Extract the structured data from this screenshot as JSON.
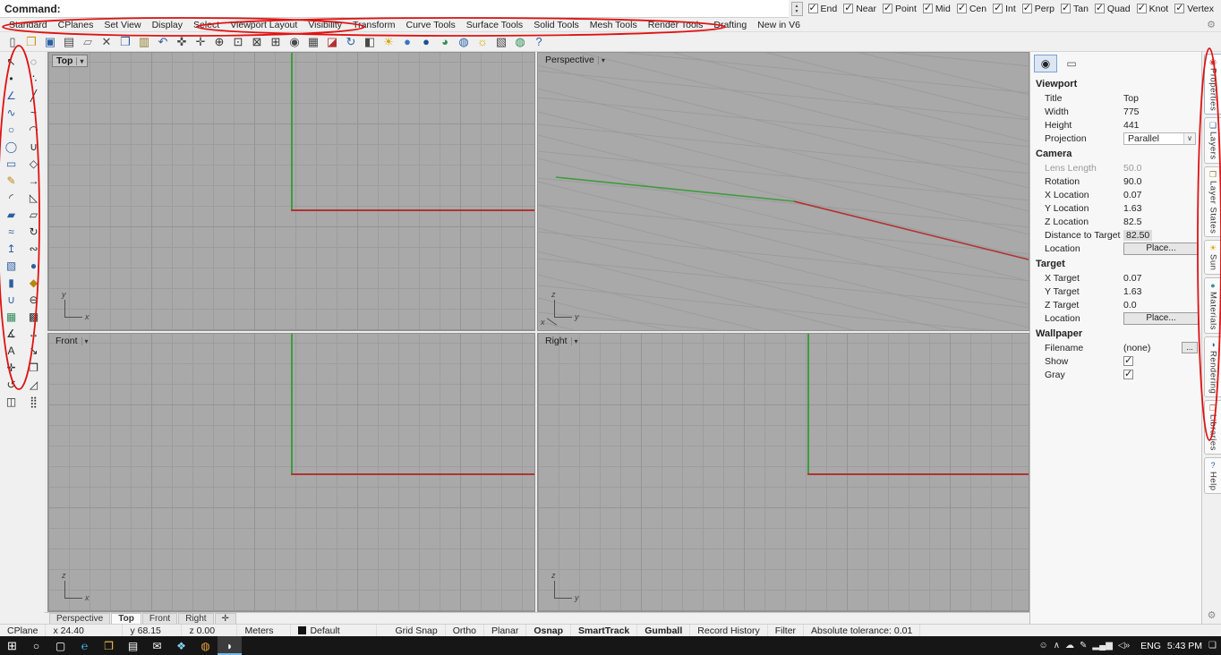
{
  "command_bar": {
    "label": "Command:",
    "value": ""
  },
  "osnap_toggles": [
    {
      "label": "End",
      "checked": true
    },
    {
      "label": "Near",
      "checked": true
    },
    {
      "label": "Point",
      "checked": true
    },
    {
      "label": "Mid",
      "checked": true
    },
    {
      "label": "Cen",
      "checked": true
    },
    {
      "label": "Int",
      "checked": true
    },
    {
      "label": "Perp",
      "checked": true
    },
    {
      "label": "Tan",
      "checked": true
    },
    {
      "label": "Quad",
      "checked": true
    },
    {
      "label": "Knot",
      "checked": true
    },
    {
      "label": "Vertex",
      "checked": true
    }
  ],
  "menu_tabs": [
    "Standard",
    "CPlanes",
    "Set View",
    "Display",
    "Select",
    "Viewport Layout",
    "Visibility",
    "Transform",
    "Curve Tools",
    "Surface Tools",
    "Solid Tools",
    "Mesh Tools",
    "Render Tools",
    "Drafting",
    "New in V6"
  ],
  "toolbar_icons": [
    {
      "name": "new-file-icon",
      "glyph": "▯",
      "color": "#4a4a4a"
    },
    {
      "name": "open-file-icon",
      "glyph": "❒",
      "color": "#c9971f"
    },
    {
      "name": "save-icon",
      "glyph": "▣",
      "color": "#2e5fa3"
    },
    {
      "name": "print-icon",
      "glyph": "▤",
      "color": "#4a4a4a"
    },
    {
      "name": "export-icon",
      "glyph": "▱",
      "color": "#777777"
    },
    {
      "name": "cut-icon",
      "glyph": "✕",
      "color": "#4a4a4a"
    },
    {
      "name": "copy-icon",
      "glyph": "❐",
      "color": "#2e5fa3"
    },
    {
      "name": "paste-icon",
      "glyph": "▥",
      "color": "#8a7a2a"
    },
    {
      "name": "undo-icon",
      "glyph": "↶",
      "color": "#2e5fa3"
    },
    {
      "name": "pan-icon",
      "glyph": "✜",
      "color": "#4a4a4a"
    },
    {
      "name": "move-icon",
      "glyph": "✛",
      "color": "#4a4a4a"
    },
    {
      "name": "zoom-dynamic-icon",
      "glyph": "⊕",
      "color": "#333333"
    },
    {
      "name": "zoom-window-icon",
      "glyph": "⊡",
      "color": "#333333"
    },
    {
      "name": "zoom-extents-icon",
      "glyph": "⊠",
      "color": "#333333"
    },
    {
      "name": "zoom-selected-icon",
      "glyph": "⊞",
      "color": "#333333"
    },
    {
      "name": "selection-filter-icon",
      "glyph": "◉",
      "color": "#4a4a4a"
    },
    {
      "name": "grid-table-icon",
      "glyph": "▦",
      "color": "#4a4a4a"
    },
    {
      "name": "erase-icon",
      "glyph": "◪",
      "color": "#b03333"
    },
    {
      "name": "rotate-view-icon",
      "glyph": "↻",
      "color": "#2e5fa3"
    },
    {
      "name": "set-view-icon",
      "glyph": "◧",
      "color": "#4a4a4a"
    },
    {
      "name": "lamp-icon",
      "glyph": "☀",
      "color": "#d8a400"
    },
    {
      "name": "shaded-view-icon",
      "glyph": "●",
      "color": "#3b74c4"
    },
    {
      "name": "rendered-view-icon",
      "glyph": "●",
      "color": "#1f4f8f"
    },
    {
      "name": "rotate-sphere-icon",
      "glyph": "◕",
      "color": "#2e8b57"
    },
    {
      "name": "globe-icon",
      "glyph": "◍",
      "color": "#2e5fa3"
    },
    {
      "name": "sun-icon",
      "glyph": "☼",
      "color": "#d8a400"
    },
    {
      "name": "cplane-icon",
      "glyph": "▧",
      "color": "#4a4a4a"
    },
    {
      "name": "earth-icon",
      "glyph": "◍",
      "color": "#2e8b57"
    },
    {
      "name": "help-icon",
      "glyph": "?",
      "color": "#2e5fa3"
    }
  ],
  "left_toolbar_icons": [
    {
      "name": "select-pointer-icon",
      "glyph": "↖",
      "color": "#2b2b2b"
    },
    {
      "name": "lasso-select-icon",
      "glyph": "◌",
      "color": "#2b2b2b"
    },
    {
      "name": "point-icon",
      "glyph": "•",
      "color": "#2b2b2b"
    },
    {
      "name": "point-cloud-icon",
      "glyph": "∴",
      "color": "#2b2b2b"
    },
    {
      "name": "polyline-icon",
      "glyph": "∠",
      "color": "#2e5fa3"
    },
    {
      "name": "line-icon",
      "glyph": "╱",
      "color": "#2b2b2b"
    },
    {
      "name": "curve-icon",
      "glyph": "∿",
      "color": "#2e5fa3"
    },
    {
      "name": "interpolate-curve-icon",
      "glyph": "~",
      "color": "#2b2b2b"
    },
    {
      "name": "circle-icon",
      "glyph": "○",
      "color": "#2e5fa3"
    },
    {
      "name": "arc-icon",
      "glyph": "◠",
      "color": "#2b2b2b"
    },
    {
      "name": "ellipse-icon",
      "glyph": "◯",
      "color": "#2e5fa3"
    },
    {
      "name": "conic-icon",
      "glyph": "∪",
      "color": "#2b2b2b"
    },
    {
      "name": "rectangle-icon",
      "glyph": "▭",
      "color": "#2e5fa3"
    },
    {
      "name": "polygon-icon",
      "glyph": "◇",
      "color": "#2b2b2b"
    },
    {
      "name": "curve-tools-icon",
      "glyph": "✎",
      "color": "#b8860b"
    },
    {
      "name": "extend-curve-icon",
      "glyph": "→",
      "color": "#2b2b2b"
    },
    {
      "name": "fillet-corner-icon",
      "glyph": "◜",
      "color": "#2b2b2b"
    },
    {
      "name": "chamfer-corner-icon",
      "glyph": "◺",
      "color": "#2b2b2b"
    },
    {
      "name": "surface-icon",
      "glyph": "▰",
      "color": "#2e5fa3"
    },
    {
      "name": "surface-corner-points-icon",
      "glyph": "▱",
      "color": "#2b2b2b"
    },
    {
      "name": "loft-icon",
      "glyph": "≈",
      "color": "#2e5fa3"
    },
    {
      "name": "revolve-icon",
      "glyph": "↻",
      "color": "#2b2b2b"
    },
    {
      "name": "extrude-icon",
      "glyph": "↥",
      "color": "#2e5fa3"
    },
    {
      "name": "sweep-icon",
      "glyph": "∾",
      "color": "#2b2b2b"
    },
    {
      "name": "box-icon",
      "glyph": "▧",
      "color": "#2e5fa3"
    },
    {
      "name": "sphere-icon",
      "glyph": "●",
      "color": "#2e5fa3"
    },
    {
      "name": "cylinder-icon",
      "glyph": "▮",
      "color": "#2e5fa3"
    },
    {
      "name": "solid-tools-icon",
      "glyph": "◆",
      "color": "#b8860b"
    },
    {
      "name": "boolean-union-icon",
      "glyph": "∪",
      "color": "#2e5fa3"
    },
    {
      "name": "boolean-difference-icon",
      "glyph": "⊖",
      "color": "#2b2b2b"
    },
    {
      "name": "mesh-icon",
      "glyph": "▦",
      "color": "#2e8b57"
    },
    {
      "name": "mesh-tools-icon",
      "glyph": "▩",
      "color": "#2b2b2b"
    },
    {
      "name": "analyze-icon",
      "glyph": "∡",
      "color": "#2b2b2b"
    },
    {
      "name": "dimension-icon",
      "glyph": "↔",
      "color": "#2b2b2b"
    },
    {
      "name": "text-icon",
      "glyph": "A",
      "color": "#2b2b2b"
    },
    {
      "name": "leader-icon",
      "glyph": "↘",
      "color": "#2b2b2b"
    },
    {
      "name": "move-tool-icon",
      "glyph": "✛",
      "color": "#2b2b2b"
    },
    {
      "name": "copy-tool-icon",
      "glyph": "❐",
      "color": "#2b2b2b"
    },
    {
      "name": "rotate-tool-icon",
      "glyph": "↺",
      "color": "#2b2b2b"
    },
    {
      "name": "scale-tool-icon",
      "glyph": "◿",
      "color": "#2b2b2b"
    },
    {
      "name": "mirror-icon",
      "glyph": "◫",
      "color": "#2b2b2b"
    },
    {
      "name": "array-icon",
      "glyph": "⣿",
      "color": "#2b2b2b"
    }
  ],
  "viewports": {
    "top": {
      "title": "Top",
      "axis_h": "x",
      "axis_v": "y"
    },
    "perspective": {
      "title": "Perspective",
      "axis_1": "z",
      "axis_2": "y",
      "axis_3": "x"
    },
    "front": {
      "title": "Front",
      "axis_h": "x",
      "axis_v": "z"
    },
    "right": {
      "title": "Right",
      "axis_h": "y",
      "axis_v": "z"
    }
  },
  "viewport_tabs": [
    {
      "label": "Perspective",
      "name": "viewport-page-tab-perspective"
    },
    {
      "label": "Top",
      "name": "viewport-page-tab-top",
      "active": true
    },
    {
      "label": "Front",
      "name": "viewport-page-tab-front"
    },
    {
      "label": "Right",
      "name": "viewport-page-tab-right"
    },
    {
      "label": "✛",
      "name": "add-viewport-tab"
    }
  ],
  "properties_panel": {
    "viewport": {
      "header": "Viewport",
      "title": {
        "label": "Title",
        "value": "Top"
      },
      "width": {
        "label": "Width",
        "value": "775"
      },
      "height": {
        "label": "Height",
        "value": "441"
      },
      "projection": {
        "label": "Projection",
        "value": "Parallel"
      }
    },
    "camera": {
      "header": "Camera",
      "lens_length": {
        "label": "Lens Length",
        "value": "50.0"
      },
      "rotation": {
        "label": "Rotation",
        "value": "90.0"
      },
      "x_location": {
        "label": "X Location",
        "value": "0.07"
      },
      "y_location": {
        "label": "Y Location",
        "value": "1.63"
      },
      "z_location": {
        "label": "Z Location",
        "value": "82.5"
      },
      "distance_to_target": {
        "label": "Distance to Target",
        "value": "82.50"
      },
      "location": {
        "label": "Location",
        "button": "Place..."
      }
    },
    "target": {
      "header": "Target",
      "x_target": {
        "label": "X Target",
        "value": "0.07"
      },
      "y_target": {
        "label": "Y Target",
        "value": "1.63"
      },
      "z_target": {
        "label": "Z Target",
        "value": "0.0"
      },
      "location": {
        "label": "Location",
        "button": "Place..."
      }
    },
    "wallpaper": {
      "header": "Wallpaper",
      "filename": {
        "label": "Filename",
        "value": "(none)",
        "button": "..."
      },
      "show": {
        "label": "Show",
        "checked": true
      },
      "gray": {
        "label": "Gray",
        "checked": true
      }
    }
  },
  "side_tabs": [
    {
      "label": "Properties",
      "name": "tab-properties",
      "glyph": "◉",
      "color": "#c23b3b",
      "active": true
    },
    {
      "label": "Layers",
      "name": "tab-layers",
      "glyph": "❏",
      "color": "#2e5fa3"
    },
    {
      "label": "Layer States",
      "name": "tab-layer-states",
      "glyph": "❐",
      "color": "#8a7a2a"
    },
    {
      "label": "Sun",
      "name": "tab-sun",
      "glyph": "☀",
      "color": "#d8a400"
    },
    {
      "label": "Materials",
      "name": "tab-materials",
      "glyph": "●",
      "color": "#3b8f8f"
    },
    {
      "label": "Rendering",
      "name": "tab-rendering",
      "glyph": "◑",
      "color": "#2e5fa3"
    },
    {
      "label": "Libraries",
      "name": "tab-libraries",
      "glyph": "❒",
      "color": "#a0522d"
    },
    {
      "label": "Help",
      "name": "tab-help",
      "glyph": "?",
      "color": "#2e5fa3"
    }
  ],
  "status_bar": {
    "left": [
      {
        "text": "CPlane",
        "name": "cplane-pane"
      },
      {
        "text": "x 24.40",
        "name": "x-coordinate"
      },
      {
        "text": "y 68.15",
        "name": "y-coordinate"
      },
      {
        "text": "z 0.00",
        "name": "z-coordinate"
      },
      {
        "text": "Meters",
        "name": "units-pane"
      },
      {
        "text": "Default",
        "name": "layer-pane",
        "swatch": true
      }
    ],
    "right": [
      {
        "text": "Grid Snap",
        "name": "grid-snap-toggle"
      },
      {
        "text": "Ortho",
        "name": "ortho-toggle"
      },
      {
        "text": "Planar",
        "name": "planar-toggle"
      },
      {
        "text": "Osnap",
        "name": "osnap-toggle",
        "bold": true
      },
      {
        "text": "SmartTrack",
        "name": "smarttrack-toggle",
        "bold": true
      },
      {
        "text": "Gumball",
        "name": "gumball-toggle",
        "bold": true
      },
      {
        "text": "Record History",
        "name": "record-history-toggle"
      },
      {
        "text": "Filter",
        "name": "filter-toggle"
      },
      {
        "text": "Absolute tolerance: 0.01",
        "name": "tolerance-display"
      }
    ]
  },
  "taskbar": {
    "icons": [
      {
        "name": "start-button",
        "glyph": "⊞",
        "color": "#ffffff"
      },
      {
        "name": "cortana-icon",
        "glyph": "○",
        "color": "#ffffff"
      },
      {
        "name": "task-view-icon",
        "glyph": "▢",
        "color": "#ffffff"
      },
      {
        "name": "edge-icon",
        "glyph": "℮",
        "color": "#4cc2ff"
      },
      {
        "name": "file-explorer-icon",
        "glyph": "❒",
        "color": "#f0c24b"
      },
      {
        "name": "store-icon",
        "glyph": "▤",
        "color": "#ffffff"
      },
      {
        "name": "mail-icon",
        "glyph": "✉",
        "color": "#ffffff"
      },
      {
        "name": "photos-icon",
        "glyph": "❖",
        "color": "#7fd4f0"
      },
      {
        "name": "browser-icon",
        "glyph": "◍",
        "color": "#e8a33c"
      },
      {
        "name": "rhino-icon",
        "glyph": "◗",
        "color": "#ffffff",
        "active": true
      }
    ],
    "tray_icons": [
      {
        "name": "people-icon",
        "glyph": "☺",
        "color": "#e4e4e4"
      },
      {
        "name": "hidden-icons-chevron",
        "glyph": "∧",
        "color": "#e4e4e4"
      },
      {
        "name": "onedrive-icon",
        "glyph": "☁",
        "color": "#e4e4e4"
      },
      {
        "name": "pen-icon",
        "glyph": "✎",
        "color": "#e4e4e4"
      },
      {
        "name": "network-icon",
        "glyph": "▂▄▆",
        "color": "#e4e4e4"
      },
      {
        "name": "volume-icon",
        "glyph": "◁»",
        "color": "#e4e4e4"
      }
    ],
    "language": "ENG",
    "time": "5:43 PM"
  },
  "colors": {
    "axis_x": "#b03333",
    "axis_y": "#3f9b3f",
    "annotation": "#e01212",
    "viewport_bg": "#a9a9a9"
  }
}
